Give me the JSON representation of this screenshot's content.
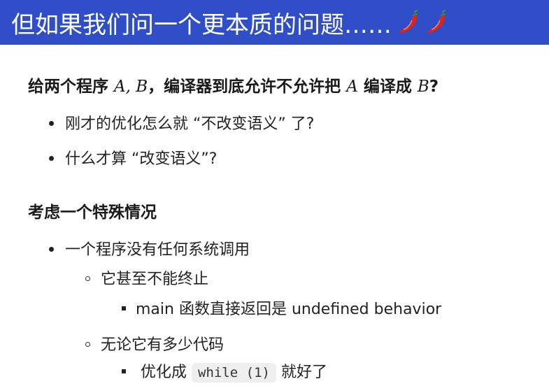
{
  "title": {
    "text": "但如果我们问一个更本质的问题……",
    "icons": [
      "chili-pepper-icon",
      "chili-pepper-icon"
    ],
    "bar_color": "#2f4ec7"
  },
  "section1": {
    "pre": "给两个程序 ",
    "var_a": "A",
    "comma": ", ",
    "var_b": "B",
    "mid": "，编译器到底允许不允许把 ",
    "var_a2": "A",
    "mid2": " 编译成 ",
    "var_b2": "B",
    "end": "?",
    "bullets": [
      "刚才的优化怎么就 “不改变语义” 了?",
      "什么才算 “改变语义”?"
    ]
  },
  "section2": {
    "heading": "考虑一个特殊情况",
    "bullet": "一个程序没有任何系统调用",
    "sub1": "它甚至不能终止",
    "sub1_item": "main 函数直接返回是 undefined behavior",
    "sub2": "无论它有多少代码",
    "sub2_item_pre": "优化成",
    "sub2_code": "while (1)",
    "sub2_item_post": "就好了"
  }
}
